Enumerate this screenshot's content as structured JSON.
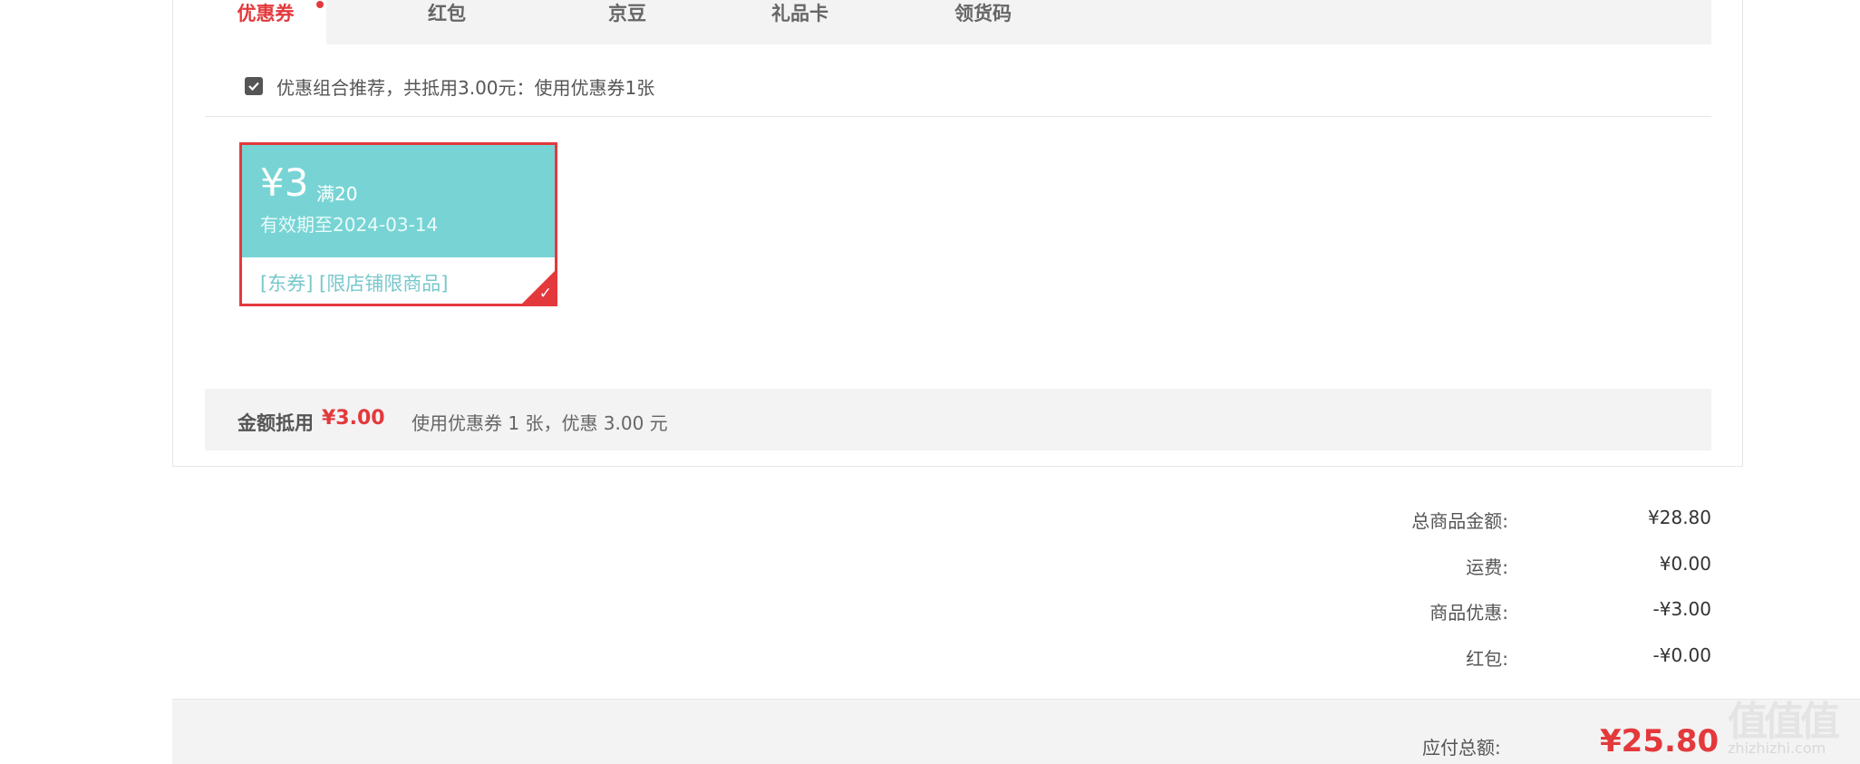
{
  "tabs": [
    {
      "label": "优惠券",
      "active": true
    },
    {
      "label": "红包",
      "active": false
    },
    {
      "label": "京豆",
      "active": false
    },
    {
      "label": "礼品卡",
      "active": false
    },
    {
      "label": "领货码",
      "active": false
    }
  ],
  "combo": {
    "checked": true,
    "text": "优惠组合推荐，共抵用3.00元：使用优惠券1张"
  },
  "coupon": {
    "amount": "¥3",
    "condition": "满20",
    "validity": "有效期至2024-03-14",
    "tags": "[东券]  [限店铺限商品]",
    "selected": true
  },
  "deduction": {
    "label": "金额抵用",
    "amount": "¥3.00",
    "description": "使用优惠券 1 张，优惠 3.00 元"
  },
  "summary": [
    {
      "label": "总商品金额:",
      "value": "¥28.80"
    },
    {
      "label": "运费:",
      "value": "¥0.00"
    },
    {
      "label": "商品优惠:",
      "value": "-¥3.00"
    },
    {
      "label": "红包:",
      "value": "-¥0.00"
    }
  ],
  "total": {
    "label": "应付总额:",
    "value": "¥25.80"
  },
  "watermark": {
    "logo": "值值值",
    "url": "zhizhizhi.com"
  },
  "colors": {
    "accent": "#e4393c",
    "coupon_bg": "#78d4d4",
    "bar_bg": "#f3f3f3"
  }
}
